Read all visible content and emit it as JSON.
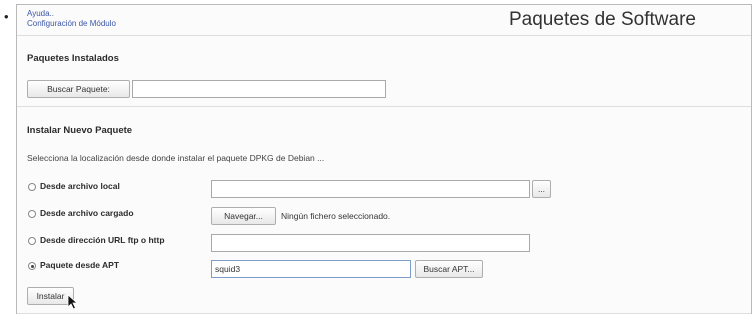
{
  "bullet": "•",
  "links": {
    "help": "Ayuda..",
    "module_config": "Configuración de Módulo"
  },
  "page_title": "Paquetes de Software",
  "installed": {
    "title": "Paquetes Instalados",
    "search_button": "Buscar Paquete:",
    "search_value": ""
  },
  "install": {
    "title": "Instalar Nuevo Paquete",
    "help_text": "Selecciona la localización desde donde instalar el paquete DPKG de Debian ...",
    "options": {
      "local_file": {
        "label": "Desde archivo local",
        "value": "",
        "browse_label": "...",
        "checked": false
      },
      "uploaded_file": {
        "label": "Desde archivo cargado",
        "browse_label": "Navegar...",
        "status": "Ningún fichero seleccionado.",
        "checked": false
      },
      "url": {
        "label": "Desde dirección URL ftp o http",
        "value": "",
        "checked": false
      },
      "apt": {
        "label": "Paquete desde APT",
        "value": "squid3",
        "search_button": "Buscar APT...",
        "checked": true
      }
    },
    "submit_button": "Instalar"
  }
}
